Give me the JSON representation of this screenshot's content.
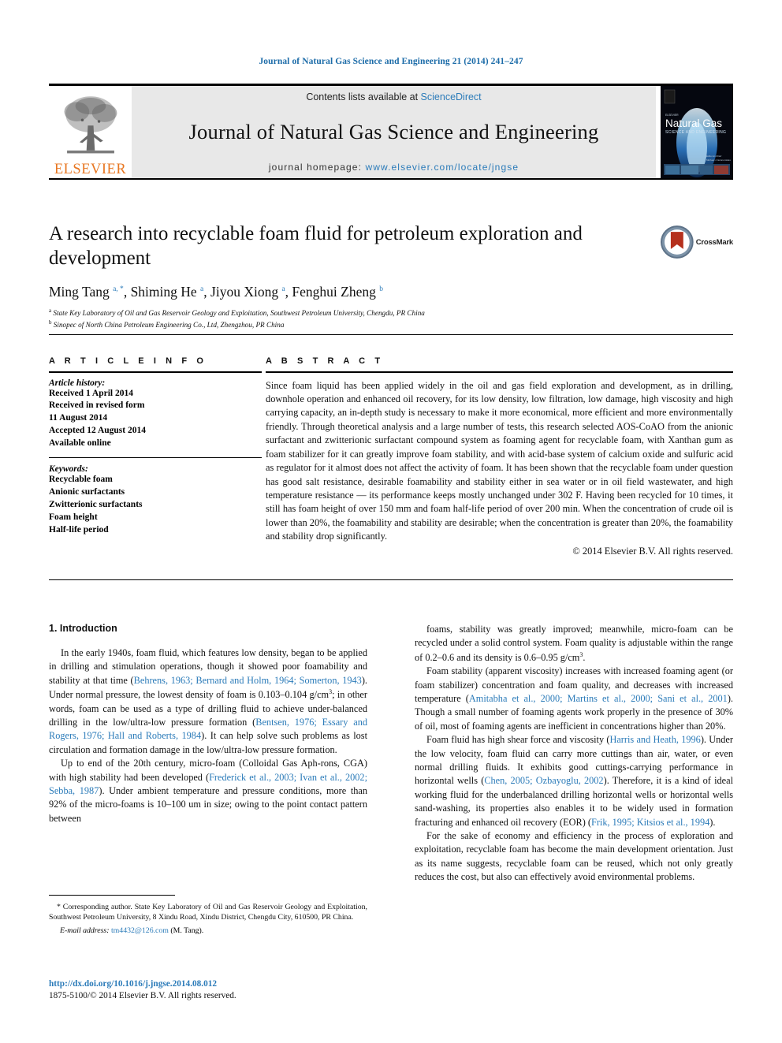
{
  "running_head": "Journal of Natural Gas Science and Engineering 21 (2014) 241–247",
  "header": {
    "contents_prefix": "Contents lists available at ",
    "sciencedirect": "ScienceDirect",
    "journal_name": "Journal of Natural Gas Science and Engineering",
    "homepage_prefix": "journal homepage: ",
    "homepage_url": "www.elsevier.com/locate/jngse",
    "publisher_logo_text": "ELSEVIER",
    "cover": {
      "title": "Natural Gas",
      "subtitle": "SCIENCE AND ENGINEERING",
      "imprint": "ELSEVIER"
    },
    "colors": {
      "link": "#2b7bb9",
      "elsevier_orange": "#E87722",
      "band_grey": "#e8e8e8"
    }
  },
  "article": {
    "title": "A research into recyclable foam fluid for petroleum exploration and development",
    "crossmark_label": "CrossMark",
    "authors_html": "Ming Tang <sup>a, *</sup>, Shiming He <sup>a</sup>, Jiyou Xiong <sup>a</sup>, Fenghui Zheng <sup>b</sup>",
    "affiliations": [
      {
        "marker": "a",
        "text": "State Key Laboratory of Oil and Gas Reservoir Geology and Exploitation, Southwest Petroleum University, Chengdu, PR China"
      },
      {
        "marker": "b",
        "text": "Sinopec of North China Petroleum Engineering Co., Ltd, Zhengzhou, PR China"
      }
    ]
  },
  "info": {
    "heading": "A R T I C L E  I N F O",
    "history_label": "Article history:",
    "history": [
      "Received 1 April 2014",
      "Received in revised form",
      "11 August 2014",
      "Accepted 12 August 2014",
      "Available online"
    ],
    "keywords_label": "Keywords:",
    "keywords": [
      "Recyclable foam",
      "Anionic surfactants",
      "Zwitterionic surfactants",
      "Foam height",
      "Half-life period"
    ]
  },
  "abstract": {
    "heading": "A B S T R A C T",
    "text": "Since foam liquid has been applied widely in the oil and gas field exploration and development, as in drilling, downhole operation and enhanced oil recovery, for its low density, low filtration, low damage, high viscosity and high carrying capacity, an in-depth study is necessary to make it more economical, more efficient and more environmentally friendly. Through theoretical analysis and a large number of tests, this research selected AOS-CoAO from the anionic surfactant and zwitterionic surfactant compound system as foaming agent for recyclable foam, with Xanthan gum as foam stabilizer for it can greatly improve foam stability, and with acid-base system of calcium oxide and sulfuric acid as regulator for it almost does not affect the activity of foam. It has been shown that the recyclable foam under question has good salt resistance, desirable foamability and stability either in sea water or in oil field wastewater, and high temperature resistance — its performance keeps mostly unchanged under 302 F. Having been recycled for 10 times, it still has foam height of over 150 mm and foam half-life period of over 200 min. When the concentration of crude oil is lower than 20%, the foamability and stability are desirable; when the concentration is greater than 20%, the foamability and stability drop significantly.",
    "copyright": "© 2014 Elsevier B.V. All rights reserved."
  },
  "body": {
    "section_heading": "1.  Introduction",
    "left_paragraphs": [
      "In the early 1940s, foam fluid, which features low density, began to be applied in drilling and stimulation operations, though it showed poor foamability and stability at that time (Behrens, 1963; Bernard and Holm, 1964; Somerton, 1943). Under normal pressure, the lowest density of foam is 0.103–0.104 g/cm3; in other words, foam can be used as a type of drilling fluid to achieve under-balanced drilling in the low/ultra-low pressure formation (Bentsen, 1976; Essary and Rogers, 1976; Hall and Roberts, 1984). It can help solve such problems as lost circulation and formation damage in the low/ultra-low pressure formation.",
      "Up to end of the 20th century, micro-foam (Colloidal Gas Aph-rons, CGA) with high stability had been developed (Frederick et al., 2003; Ivan et al., 2002; Sebba, 1987). Under ambient temperature and pressure conditions, more than 92% of the micro-foams is 10–100 um in size; owing to the point contact pattern between"
    ],
    "right_paragraphs": [
      "foams, stability was greatly improved; meanwhile, micro-foam can be recycled under a solid control system. Foam quality is adjustable within the range of 0.2–0.6 and its density is 0.6–0.95 g/cm3.",
      "Foam stability (apparent viscosity) increases with increased foaming agent (or foam stabilizer) concentration and foam quality, and decreases with increased temperature (Amitabha et al., 2000; Martins et al., 2000; Sani et al., 2001). Though a small number of foaming agents work properly in the presence of 30% of oil, most of foaming agents are inefficient in concentrations higher than 20%.",
      "Foam fluid has high shear force and viscosity (Harris and Heath, 1996). Under the low velocity, foam fluid can carry more cuttings than air, water, or even normal drilling fluids. It exhibits good cuttings-carrying performance in horizontal wells (Chen, 2005; Ozbayoglu, 2002). Therefore, it is a kind of ideal working fluid for the underbalanced drilling horizontal wells or horizontal wells sand-washing, its properties also enables it to be widely used in formation fracturing and enhanced oil recovery (EOR) (Frik, 1995; Kitsios et al., 1994).",
      "For the sake of economy and efficiency in the process of exploration and exploitation, recyclable foam has become the main development orientation. Just as its name suggests, recyclable foam can be reused, which not only greatly reduces the cost, but also can effectively avoid environmental problems."
    ]
  },
  "footnote": {
    "corresponding": "* Corresponding author. State Key Laboratory of Oil and Gas Reservoir Geology and Exploitation, Southwest Petroleum University, 8 Xindu Road, Xindu District, Chengdu City, 610500, PR China.",
    "email_label": "E-mail address:",
    "email": "tm4432@126.com",
    "email_suffix": "(M. Tang).",
    "doi": "http://dx.doi.org/10.1016/j.jngse.2014.08.012",
    "issn_line": "1875-5100/© 2014 Elsevier B.V. All rights reserved."
  }
}
